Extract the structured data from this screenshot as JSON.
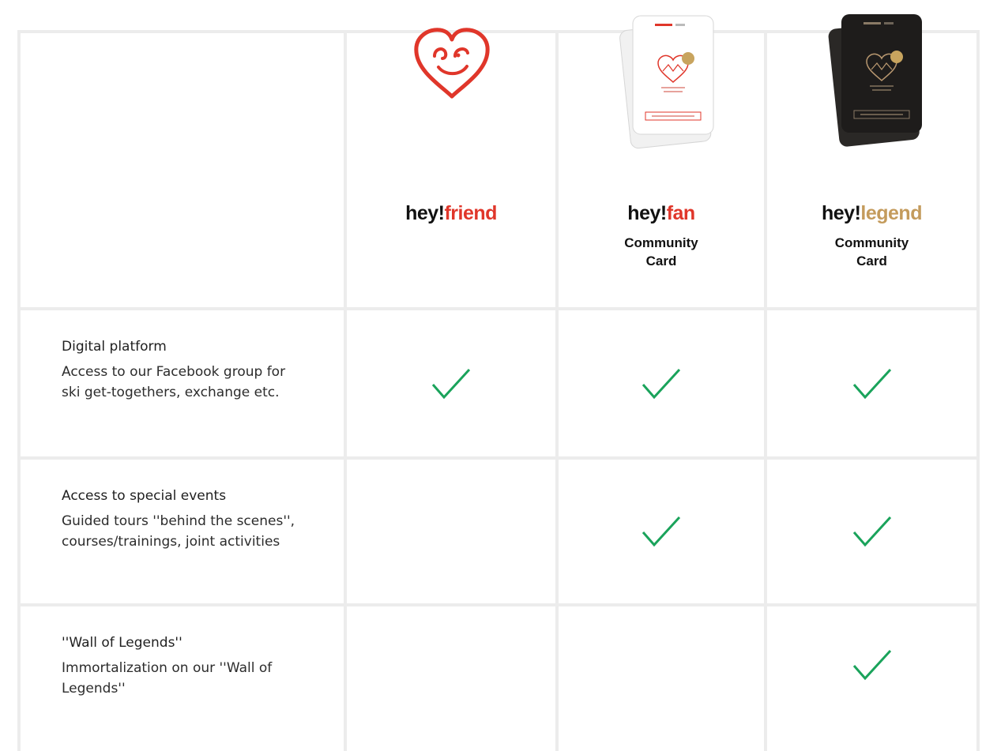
{
  "columns": [
    {
      "brand_prefix": "hey!",
      "brand_name": "friend",
      "accent": "#e0362a"
    },
    {
      "brand_prefix": "hey!",
      "brand_name": "fan",
      "accent": "#e0362a",
      "sub_line1": "Community",
      "sub_line2": "Card"
    },
    {
      "brand_prefix": "hey!",
      "brand_name": "legend",
      "accent": "#c49b5c",
      "sub_line1": "Community",
      "sub_line2": "Card"
    }
  ],
  "features": [
    {
      "title": "Digital platform",
      "desc": "Access to our Facebook group for ski get-togethers, exchange etc.",
      "included": [
        true,
        true,
        true
      ]
    },
    {
      "title": "Access to special events",
      "desc": "Guided tours ''behind the scenes'', courses/trainings, joint activities",
      "included": [
        false,
        true,
        true
      ]
    },
    {
      "title": "''Wall of Legends''",
      "desc": "Immortalization on our ''Wall of Legends''",
      "included": [
        false,
        false,
        true
      ]
    }
  ],
  "icons": {
    "heart_logo": "smiling-heart-icon",
    "fan_card": "fan-community-card-image",
    "legend_card": "legend-community-card-image",
    "check": "checkmark-icon"
  },
  "colors": {
    "check": "#1aa35b",
    "grid": "#ececec",
    "red": "#e0362a",
    "gold": "#c49b5c"
  }
}
